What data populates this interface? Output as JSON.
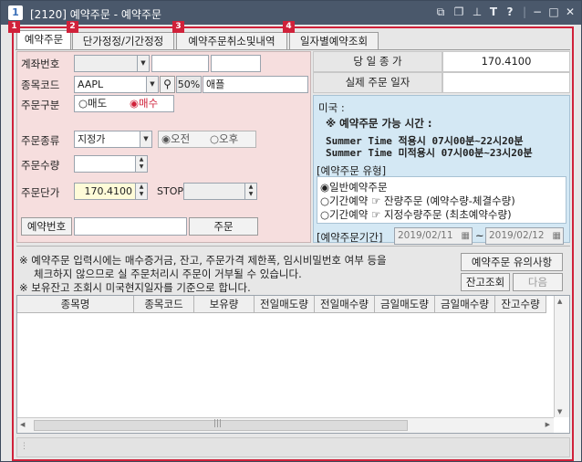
{
  "window": {
    "number": "1",
    "title": "[2120] 예약주문 - 예약주문",
    "controls": [
      "restore-down-icon",
      "copy-icon",
      "pin-icon",
      "text-icon",
      "help-icon",
      "minimize-icon",
      "maximize-icon",
      "close-icon"
    ]
  },
  "tabs": [
    {
      "badge": "1",
      "label": "예약주문",
      "active": true
    },
    {
      "badge": "2",
      "label": "단가정정/기간정정",
      "active": false
    },
    {
      "badge": "3",
      "label": "예약주문취소및내역",
      "active": false
    },
    {
      "badge": "4",
      "label": "일자별예약조회",
      "active": false
    }
  ],
  "form": {
    "account_label": "계좌번호",
    "symbol_label": "종목코드",
    "symbol_value": "AAPL",
    "symbol_pct": "50%",
    "symbol_name": "애플",
    "side_label": "주문구분",
    "side_sell": "매도",
    "side_buy": "매수",
    "type_label": "주문종류",
    "type_value": "지정가",
    "am_label": "오전",
    "pm_label": "오후",
    "qty_label": "주문수량",
    "qty_value": "",
    "price_label": "주문단가",
    "price_value": "170.4100",
    "stop_label": "STOP",
    "reservation_no_button": "예약번호",
    "order_button": "주문"
  },
  "info": {
    "close_price_label": "당 일 종 가",
    "close_price_value": "170.4100",
    "actual_date_label": "실제 주문 일자",
    "actual_date_value": "",
    "market_label": "미국 :",
    "hours_title": "※ 예약주문 가능 시간 :",
    "summer_line1": "Summer Time 적용시  07시00분~22시20분",
    "summer_line2": "Summer Time 미적용시 07시00분~23시20분",
    "order_type_title": "[예약주문 유형]",
    "order_type_normal": "일반예약주문",
    "order_type_period1": "기간예약 ☞ 잔량주문 (예약수량-체결수량)",
    "order_type_period2": "기간예약 ☞ 지정수량주문 (최초예약수량)",
    "period_label": "[예약주문기간]",
    "period_from": "2019/02/11",
    "period_tilde": "~",
    "period_to": "2019/02/12"
  },
  "notice": {
    "line1": "※ 예약주문 입력시에는 매수증거금, 잔고, 주문가격 제한폭, 임시비밀번호 여부 등을",
    "line2": "체크하지 않으므로 실 주문처리시 주문이 거부될 수 있습니다.",
    "line3": "※ 보유잔고 조회시 미국현지일자를 기준으로 합니다.",
    "caution_button": "예약주문 유의사항",
    "balance_button": "잔고조회",
    "next_button": "다음"
  },
  "grid": {
    "columns": [
      "종목명",
      "종목코드",
      "보유량",
      "전일매도량",
      "전일매수량",
      "금일매도량",
      "금일매수량",
      "잔고수량"
    ],
    "rows": []
  }
}
